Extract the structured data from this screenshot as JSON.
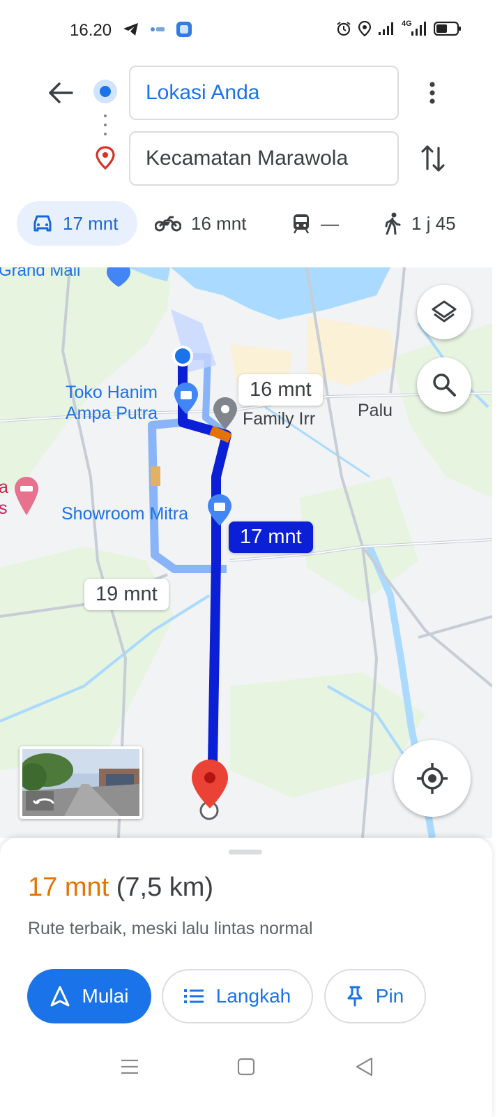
{
  "status_bar": {
    "time": "16.20",
    "left_icons": [
      "telegram-icon",
      "app-icon",
      "app-square-icon"
    ],
    "right_icons": [
      "alarm-icon",
      "location-icon",
      "signal-icon",
      "4g-signal-icon",
      "battery-icon"
    ],
    "network": "4G"
  },
  "directions": {
    "origin": "Lokasi Anda",
    "destination": "Kecamatan Marawola"
  },
  "modes": [
    {
      "name": "car",
      "label": "17 mnt",
      "active": true
    },
    {
      "name": "motorcycle",
      "label": "16 mnt",
      "active": false
    },
    {
      "name": "transit",
      "label": "—",
      "active": false
    },
    {
      "name": "walk",
      "label": "1 j 45",
      "active": false
    }
  ],
  "map": {
    "labels": {
      "grand_mall": "Grand Mall",
      "toko": "Toko Hanim\nAmpa Putra",
      "family": "Family Irr",
      "palu": "Palu",
      "showroom": "Showroom Mitra",
      "hotel_partial": "a\ns"
    },
    "route_tags": {
      "alt_a": "16 mnt",
      "selected": "17 mnt",
      "alt_b": "19 mnt"
    },
    "colors": {
      "route_selected": "#0b1fd6",
      "route_alt": "#8ab4f8",
      "water": "#aadaff",
      "park": "#e6f4e0",
      "destination_pin": "#ea4335"
    }
  },
  "summary": {
    "duration": "17 mnt",
    "distance": "(7,5 km)",
    "description": "Rute terbaik, meski lalu lintas normal"
  },
  "actions": {
    "start": "Mulai",
    "steps": "Langkah",
    "pin": "Pin"
  }
}
